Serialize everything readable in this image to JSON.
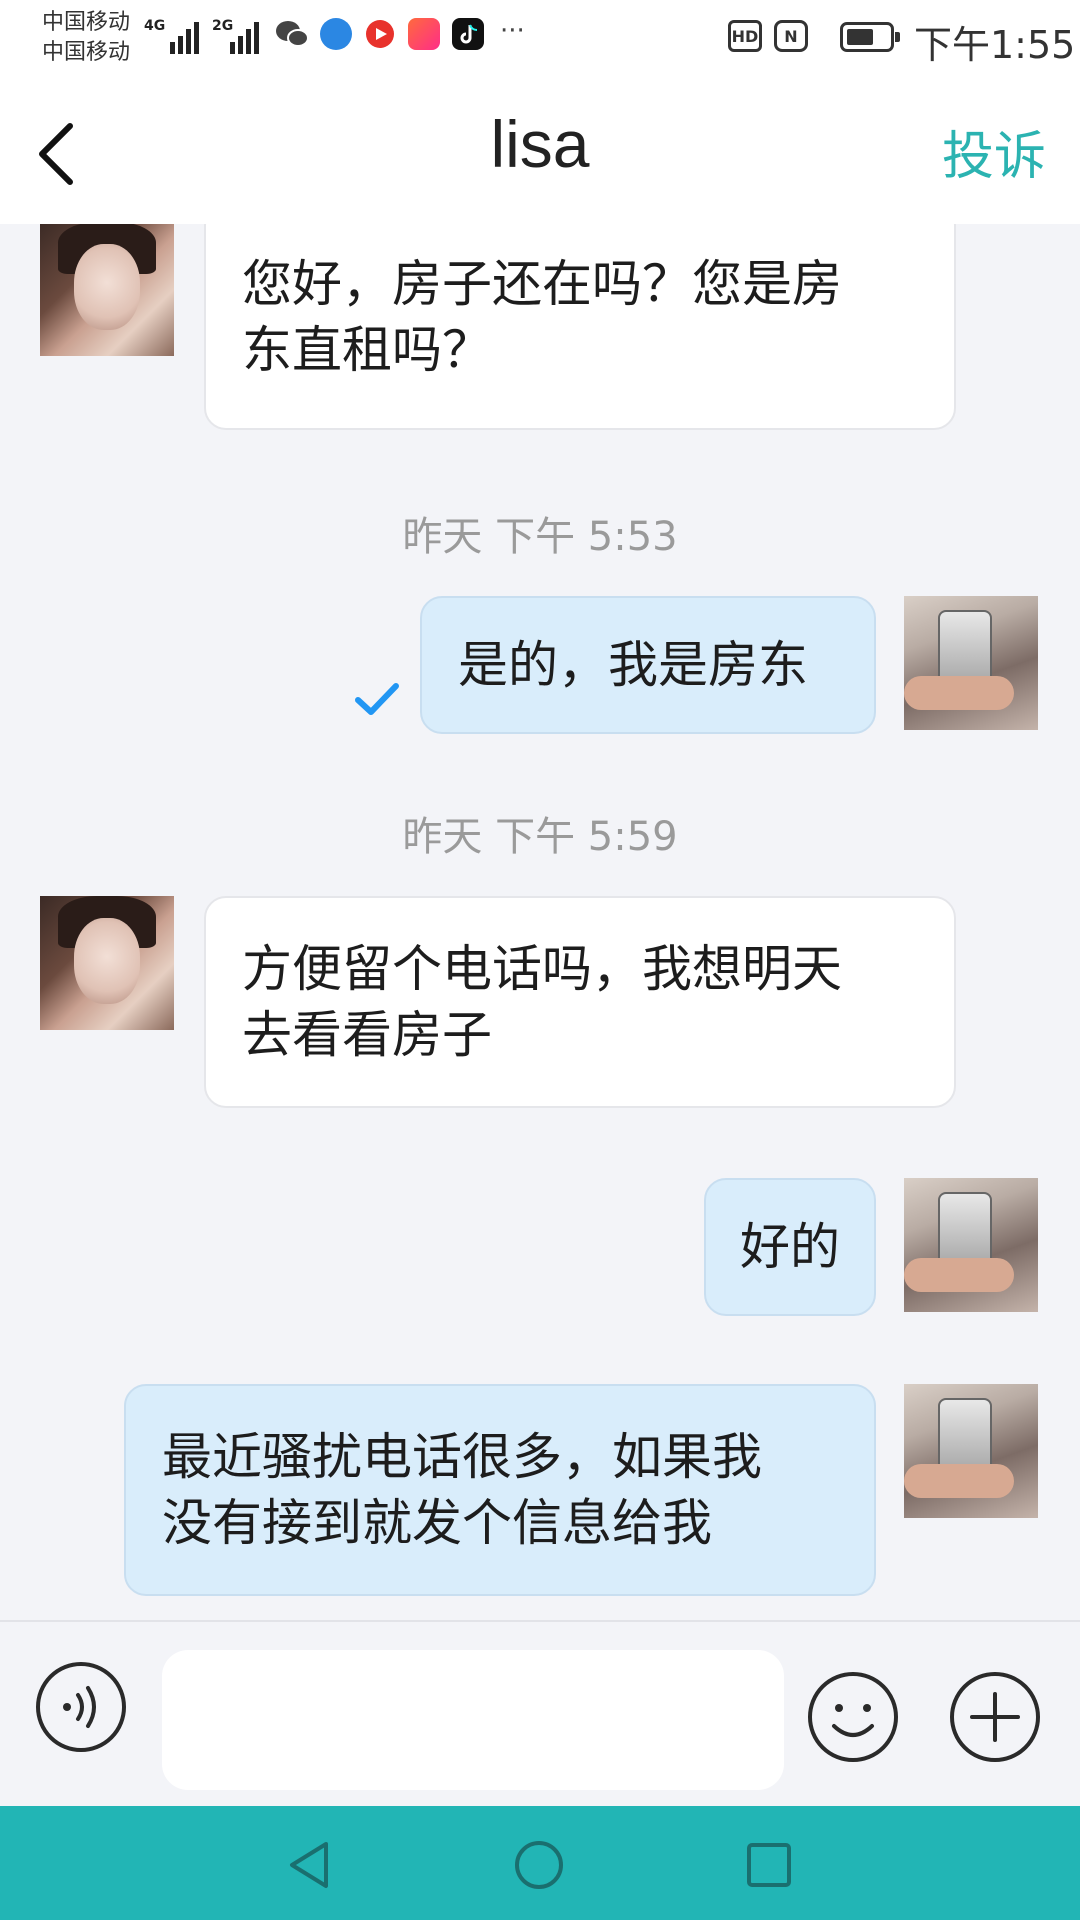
{
  "status_bar": {
    "carrier_1": "中国移动",
    "carrier_2": "中国移动",
    "network_1": "4G",
    "network_2": "2G",
    "hd_label": "HD",
    "nfc_label": "N",
    "time": "下午1:55",
    "more": "···",
    "app_icons": [
      "wechat-icon",
      "browser-icon",
      "video-icon",
      "kuaishou-icon",
      "tiktok-icon"
    ]
  },
  "header": {
    "title": "lisa",
    "action_label": "投诉",
    "accent_color": "#2bb3b1"
  },
  "messages": [
    {
      "id": "m1",
      "direction": "incoming",
      "text_line_1": "您好，房子还在吗？您是房",
      "text_line_2": "东直租吗？"
    },
    {
      "id": "t1",
      "type": "timestamp",
      "text": "昨天 下午 5:53"
    },
    {
      "id": "m2",
      "direction": "outgoing",
      "text": "是的，我是房东",
      "read": true
    },
    {
      "id": "t2",
      "type": "timestamp",
      "text": "昨天 下午 5:59"
    },
    {
      "id": "m3",
      "direction": "incoming",
      "text_line_1": "方便留个电话吗，我想明天",
      "text_line_2": "去看看房子"
    },
    {
      "id": "m4",
      "direction": "outgoing",
      "text": "好的"
    },
    {
      "id": "m5",
      "direction": "outgoing",
      "text_line_1": "最近骚扰电话很多，如果我",
      "text_line_2": "没有接到就发个信息给我"
    }
  ],
  "input_bar": {
    "value": "",
    "placeholder": ""
  },
  "colors": {
    "incoming_bubble": "#ffffff",
    "outgoing_bubble": "#d9edfb",
    "read_check": "#2196f3",
    "nav_bar": "#22b5b5"
  }
}
